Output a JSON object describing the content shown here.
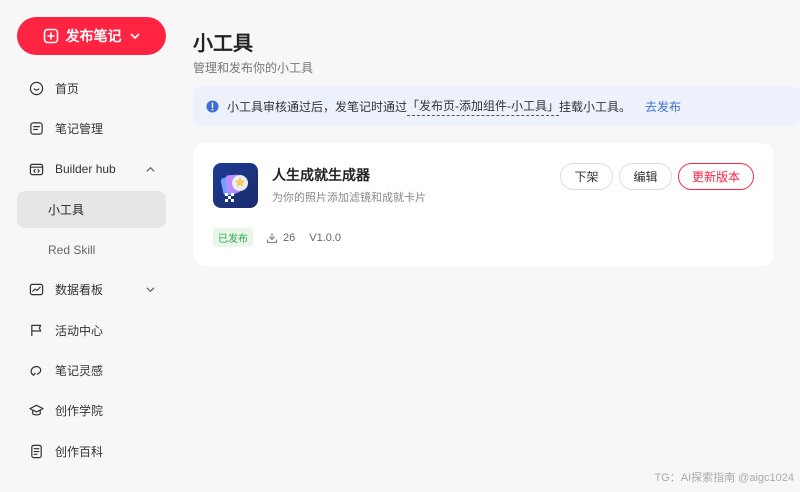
{
  "sidebar": {
    "publish_label": "发布笔记",
    "items": [
      {
        "label": "首页",
        "icon": "home-icon"
      },
      {
        "label": "笔记管理",
        "icon": "note-icon"
      },
      {
        "label": "Builder hub",
        "icon": "code-icon",
        "expanded": true
      },
      {
        "label": "小工具",
        "active": true
      },
      {
        "label": "Red Skill"
      },
      {
        "label": "数据看板",
        "icon": "chart-icon",
        "expanded": false
      },
      {
        "label": "活动中心",
        "icon": "flag-icon"
      },
      {
        "label": "笔记灵感",
        "icon": "bulb-icon"
      },
      {
        "label": "创作学院",
        "icon": "graduation-cap-icon"
      },
      {
        "label": "创作百科",
        "icon": "book-icon"
      }
    ]
  },
  "main": {
    "title": "小工具",
    "subtitle": "管理和发布你的小工具",
    "notice": {
      "text_before": "小工具审核通过后，发笔记时通过",
      "path": "「发布页-添加组件-小工具」",
      "text_after": "挂载小工具。",
      "link": "去发布"
    },
    "card": {
      "name": "人生成就生成器",
      "description": "为你的照片添加滤镜和成就卡片",
      "status": "已发布",
      "downloads": "26",
      "version": "V1.0.0",
      "actions": {
        "off_shelf": "下架",
        "edit": "编辑",
        "update": "更新版本"
      }
    }
  },
  "watermark": "TG：AI探索指南 @aigc1024",
  "colors": {
    "accent": "#ff2442",
    "link": "#3f6fd6",
    "published_bg": "#e8f7ea",
    "published_text": "#2ea54d"
  }
}
